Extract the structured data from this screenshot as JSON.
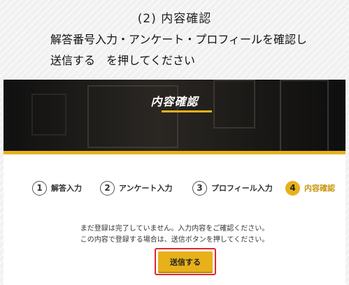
{
  "instruction": {
    "step_title": "(2) 内容確認",
    "line1": "解答番号入力・アンケート・プロフィールを確認し",
    "line2": "送信する　を押してください"
  },
  "hero": {
    "title": "内容確認"
  },
  "steps": [
    {
      "number": "1",
      "label": "解答入力",
      "active": false
    },
    {
      "number": "2",
      "label": "アンケート入力",
      "active": false
    },
    {
      "number": "3",
      "label": "プロフィール入力",
      "active": false
    },
    {
      "number": "4",
      "label": "内容確認",
      "active": true
    }
  ],
  "message": {
    "line1": "まだ登録は完了していません。入力内容をご確認ください。",
    "line2": "この内容で登録する場合は、送信ボタンを押してください。"
  },
  "submit": {
    "label": "送信する"
  },
  "colors": {
    "accent": "#e8b11a",
    "highlight": "#e1272d"
  }
}
